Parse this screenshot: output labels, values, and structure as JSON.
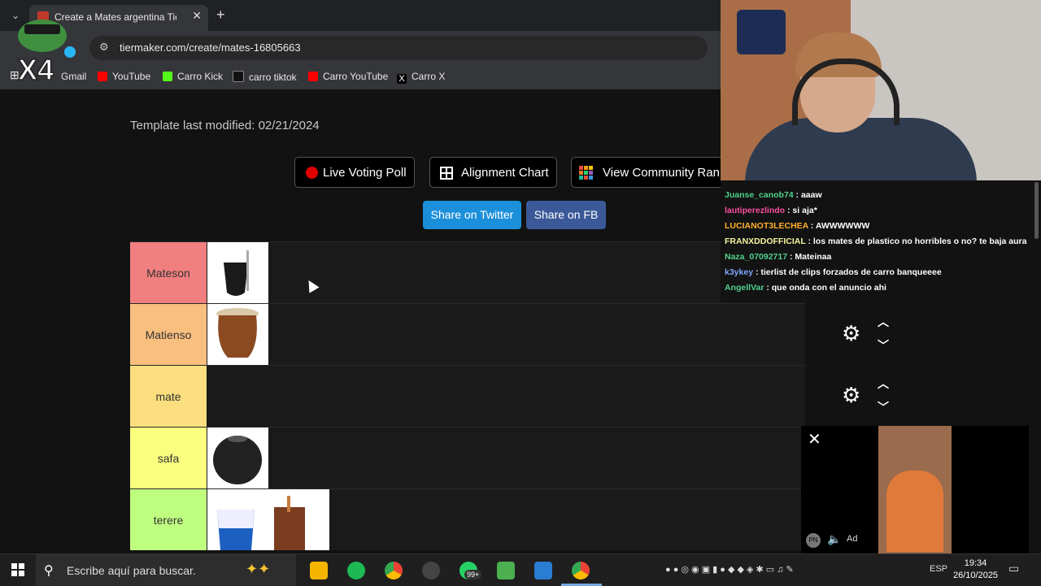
{
  "browser": {
    "tab_title": "Create a Mates argentina Tier L",
    "url": "tiermaker.com/create/mates-16805663",
    "bookmarks": [
      "Gmail",
      "YouTube",
      "Carro Kick",
      "carro tiktok",
      "Carro YouTube",
      "Carro X"
    ]
  },
  "overlay": {
    "logo_text": "X4"
  },
  "page": {
    "modified": "Template last modified: 02/21/2024",
    "buttons": {
      "live": "Live Voting Poll",
      "alignment": "Alignment Chart",
      "community": "View Community Ran"
    },
    "share_twitter": "Share on Twitter",
    "share_fb": "Share on FB"
  },
  "tiers": [
    {
      "label": "Mateson",
      "color": "#f27f7f"
    },
    {
      "label": "Matienso",
      "color": "#f8bf7f"
    },
    {
      "label": "mate",
      "color": "#fbdf7e"
    },
    {
      "label": "safa",
      "color": "#fbff7f"
    },
    {
      "label": "terere",
      "color": "#bfff7f"
    }
  ],
  "chat": [
    {
      "user": "Juanse_canob74",
      "color": "#4fd18b",
      "msg": " : aaaw"
    },
    {
      "user": "lautiperezlindo",
      "color": "#ff4fa3",
      "msg": " : si aja*"
    },
    {
      "user": "LUCIANOT3LECHEA",
      "color": "#ffb02e",
      "msg": " : AWWWWWW"
    },
    {
      "user": "FRANXDDOFFICIAL",
      "color": "#f5f5a0",
      "msg": " : los mates de plastico no horribles o no? te baja aura"
    },
    {
      "user": "Naza_07092717",
      "color": "#4fd18b",
      "msg": " : Mateinaa"
    },
    {
      "user": "k3ykey",
      "color": "#7fa8ff",
      "msg": " : tierlist de clips forzados de carro banqueeee"
    },
    {
      "user": "AngellVar",
      "color": "#4fd18b",
      "msg": " : que onda con el anuncio ahi"
    }
  ],
  "ad": {
    "pn": "PN",
    "label": "Ad"
  },
  "taskbar": {
    "search_placeholder": "Escribe aquí para buscar.",
    "badge": "99+",
    "lang": "ESP",
    "time": "19:34",
    "date": "26/10/2025"
  }
}
